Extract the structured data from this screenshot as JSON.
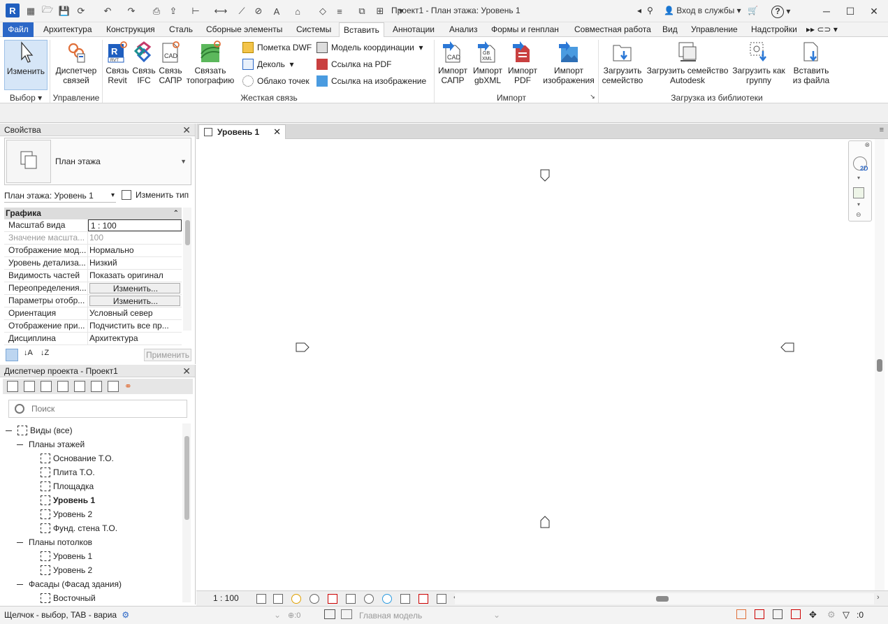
{
  "titlebar": {
    "app_letter": "R",
    "window_title": "Проект1 - План этажа: Уровень 1",
    "sign_in": "Вход в службы",
    "help": "?"
  },
  "ribbon_tabs": [
    "Файл",
    "Архитектура",
    "Конструкция",
    "Сталь",
    "Сборные элементы",
    "Системы",
    "Вставить",
    "Аннотации",
    "Анализ",
    "Формы и генплан",
    "Совместная работа",
    "Вид",
    "Управление",
    "Надстройки"
  ],
  "ribbon": {
    "modify": "Изменить",
    "link_manager_1": "Диспетчер",
    "link_manager_2": "связей",
    "link_revit_1": "Связь",
    "link_revit_2": "Revit",
    "link_ifc_1": "Связь",
    "link_ifc_2": "IFC",
    "link_cad_1": "Связь",
    "link_cad_2": "САПР",
    "link_topo_1": "Связать",
    "link_topo_2": "топографию",
    "dwf_markup": "Пометка DWF",
    "decal": "Деколь",
    "point_cloud": "Облако точек",
    "coord_model": "Модель координации",
    "pdf_link": "Ссылка на PDF",
    "image_link": "Ссылка на изображение",
    "import_cad_1": "Импорт",
    "import_cad_2": "САПР",
    "import_gbxml_1": "Импорт",
    "import_gbxml_2": "gbXML",
    "import_pdf_1": "Импорт",
    "import_pdf_2": "PDF",
    "import_image_1": "Импорт",
    "import_image_2": "изображения",
    "load_family_1": "Загрузить",
    "load_family_2": "семейство",
    "load_autodesk_1": "Загрузить семейство",
    "load_autodesk_2": "Autodesk",
    "load_group_1": "Загрузить как",
    "load_group_2": "группу",
    "insert_file_1": "Вставить",
    "insert_file_2": "из файла",
    "panel_select": "Выбор",
    "panel_manage": "Управление",
    "panel_hard_link": "Жесткая связь",
    "panel_import": "Импорт",
    "panel_library": "Загрузка из библиотеки",
    "ico_cad": "CAD",
    "ico_rvt": "RVT",
    "ico_gbxml": "GB XML"
  },
  "properties": {
    "title": "Свойства",
    "type_name": "План этажа",
    "instance": "План этажа: Уровень 1",
    "edit_type": "Изменить тип",
    "group": "Графика",
    "rows": [
      {
        "k": "Масштаб вида",
        "v": "1 : 100"
      },
      {
        "k": "Значение масшта...",
        "v": "100"
      },
      {
        "k": "Отображение мод...",
        "v": "Нормально"
      },
      {
        "k": "Уровень детализа...",
        "v": "Низкий"
      },
      {
        "k": "Видимость частей",
        "v": "Показать оригинал"
      },
      {
        "k": "Переопределения...",
        "v": "Изменить..."
      },
      {
        "k": "Параметры отобр...",
        "v": "Изменить..."
      },
      {
        "k": "Ориентация",
        "v": "Условный север"
      },
      {
        "k": "Отображение при...",
        "v": "Подчистить все пр..."
      },
      {
        "k": "Дисциплина",
        "v": "Архитектура"
      }
    ],
    "apply": "Применить"
  },
  "browser": {
    "title": "Диспетчер проекта - Проект1",
    "search_placeholder": "Поиск",
    "nodes": [
      "Виды (все)",
      "Планы этажей",
      "Основание Т.О.",
      "Плита Т.О.",
      "Площадка",
      "Уровень 1",
      "Уровень 2",
      "Фунд. стена Т.О.",
      "Планы потолков",
      "Уровень 1",
      "Уровень 2",
      "Фасады (Фасад здания)",
      "Восточный"
    ]
  },
  "view": {
    "tab_title": "Уровень 1",
    "scale": "1 : 100",
    "navbar_2d": "2D"
  },
  "status": {
    "text": "Щелчок - выбор, TAB - вариа",
    "workset_count": ":0",
    "design_option": "Главная модель",
    "filter_count": ":0"
  },
  "colors": {
    "accent": "#2b67c7",
    "selected": "#d6e6f7"
  }
}
